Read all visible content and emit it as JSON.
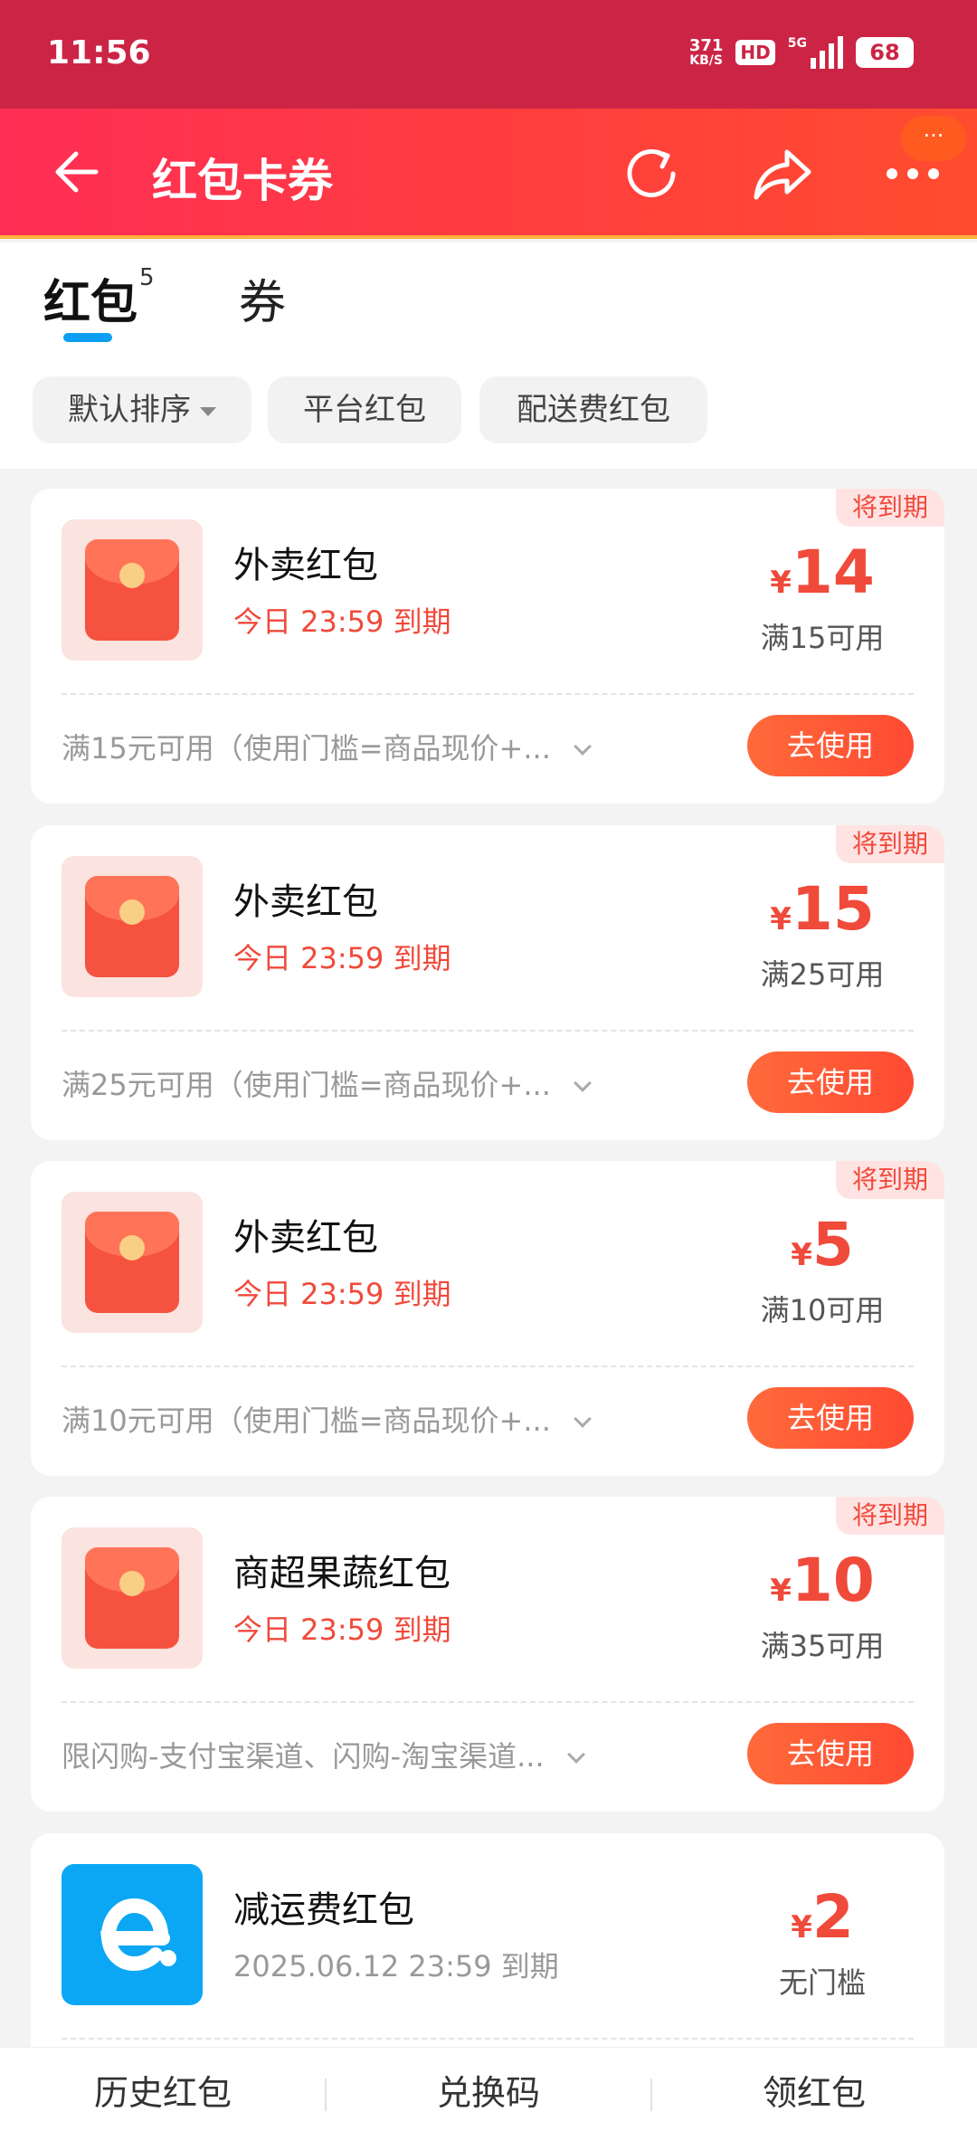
{
  "status_bar": {
    "time": "11:56",
    "net_speed_value": "371",
    "net_speed_unit": "KB/S",
    "hd": "HD",
    "signal": "5G",
    "battery": "68"
  },
  "header": {
    "title": "红包卡券",
    "more_badge": "···"
  },
  "tabs": [
    {
      "label": "红包",
      "count": "5",
      "active": true
    },
    {
      "label": "券",
      "active": false
    }
  ],
  "filters": [
    {
      "label": "默认排序"
    },
    {
      "label": "平台红包"
    },
    {
      "label": "配送费红包"
    }
  ],
  "coupons": [
    {
      "badge": "将到期",
      "title": "外卖红包",
      "expiry": "今日 23:59 到期",
      "currency": "¥",
      "amount": "14",
      "condition": "满15可用",
      "description": "满15元可用（使用门槛=商品现价+...",
      "button": "去使用"
    },
    {
      "badge": "将到期",
      "title": "外卖红包",
      "expiry": "今日 23:59 到期",
      "currency": "¥",
      "amount": "15",
      "condition": "满25可用",
      "description": "满25元可用（使用门槛=商品现价+...",
      "button": "去使用"
    },
    {
      "badge": "将到期",
      "title": "外卖红包",
      "expiry": "今日 23:59 到期",
      "currency": "¥",
      "amount": "5",
      "condition": "满10可用",
      "description": "满10元可用（使用门槛=商品现价+...",
      "button": "去使用"
    },
    {
      "badge": "将到期",
      "title": "商超果蔬红包",
      "expiry": "今日 23:59 到期",
      "currency": "¥",
      "amount": "10",
      "condition": "满35可用",
      "description": "限闪购-支付宝渠道、闪购-淘宝渠道...",
      "button": "去使用"
    },
    {
      "title": "减运费红包",
      "expiry": "2025.06.12 23:59 到期",
      "currency": "¥",
      "amount": "2",
      "condition": "无门槛"
    }
  ],
  "bottom_nav": [
    {
      "label": "历史红包"
    },
    {
      "label": "兑换码"
    },
    {
      "label": "领红包"
    }
  ],
  "colors": {
    "status_bar": "#cc2445",
    "header_gradient_start": "#ff2e55",
    "header_gradient_end": "#ff4c2f",
    "accent_red": "#f04a3b",
    "tab_indicator": "#0a9ff0",
    "eleme_blue": "#0ba7f5"
  }
}
